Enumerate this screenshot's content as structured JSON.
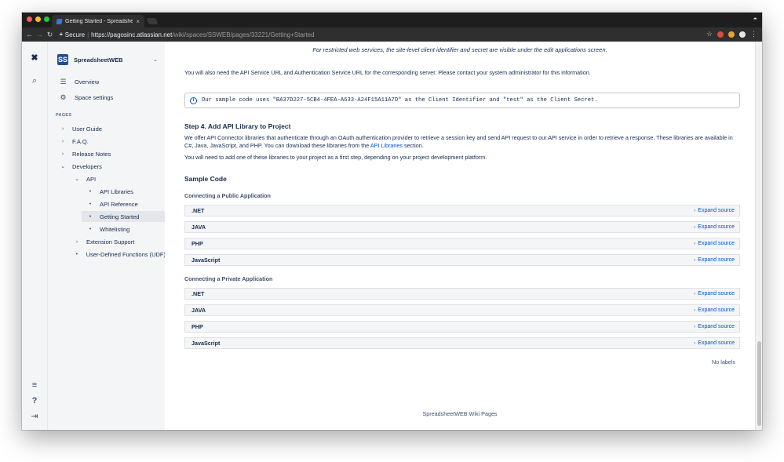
{
  "browser": {
    "tab_title": "Getting Started - Spreadsheet",
    "tab_close": "×",
    "secure_label": "Secure",
    "url_host": "https://pagosinc.atlassian.net",
    "url_path": "/wiki/spaces/SSWEB/pages/33221/Getting+Started",
    "lights": [
      "#fc5f57",
      "#fdbc2e",
      "#28c840"
    ]
  },
  "space": {
    "logo_text": "SS",
    "name": "SpreadsheetWEB",
    "links": [
      {
        "label": "Overview",
        "icon": "list-icon"
      },
      {
        "label": "Space settings",
        "icon": "gear-icon"
      }
    ]
  },
  "sidebar": {
    "pages_label": "PAGES",
    "tree": [
      {
        "label": "User Guide",
        "marker": "›"
      },
      {
        "label": "F.A.Q.",
        "marker": "›"
      },
      {
        "label": "Release Notes",
        "marker": "›"
      },
      {
        "label": "Developers",
        "marker": "⌄"
      },
      {
        "label": "API",
        "marker": "⌄"
      },
      {
        "label": "API Libraries",
        "marker": "•"
      },
      {
        "label": "API Reference",
        "marker": "•"
      },
      {
        "label": "Getting Started",
        "marker": "•",
        "active": true
      },
      {
        "label": "Whitelisting",
        "marker": "•"
      },
      {
        "label": "Extension Support",
        "marker": "›"
      },
      {
        "label": "User-Defined Functions (UDF)",
        "marker": "•"
      }
    ]
  },
  "content": {
    "italic_note": "For restricted web services, the site-level client identifier and secret are visible under the edit applications screen.",
    "para_service_urls": "You will also need the API Service URL and Authentication Service URL for the corresponding server. Please contact your system administrator for this information.",
    "info_text": "Our sample code uses \"BA37D227-5CB4-4FEA-A633-A24F15A11A7D\" as the Client Identifier and \"test\" as the Client Secret.",
    "step4_heading": "Step 4. Add API Library to Project",
    "step4_para_a": "We offer API Connector libraries that authenticate through an OAuth authentication provider to retrieve a session key and send API request to our API service in order to retrieve a response. These libraries are available in C#, Java, JavaScript, and PHP. You can download these libraries from the",
    "step4_link": "API Libraries",
    "step4_para_b": "section.",
    "step4_para2": "You will need to add one of these libraries to your project as a first step, depending on your project development platform.",
    "sample_heading": "Sample Code",
    "public_heading": "Connecting a Public Application",
    "private_heading": "Connecting a Private Application",
    "expand_label": "Expand source",
    "expand_arrow": "›",
    "public_rows": [
      ".NET",
      "JAVA",
      "PHP",
      "JavaScript"
    ],
    "private_rows": [
      ".NET",
      "JAVA",
      "PHP",
      "JavaScript"
    ],
    "no_labels": "No labels",
    "footer": "SpreadsheetWEB Wiki Pages"
  }
}
